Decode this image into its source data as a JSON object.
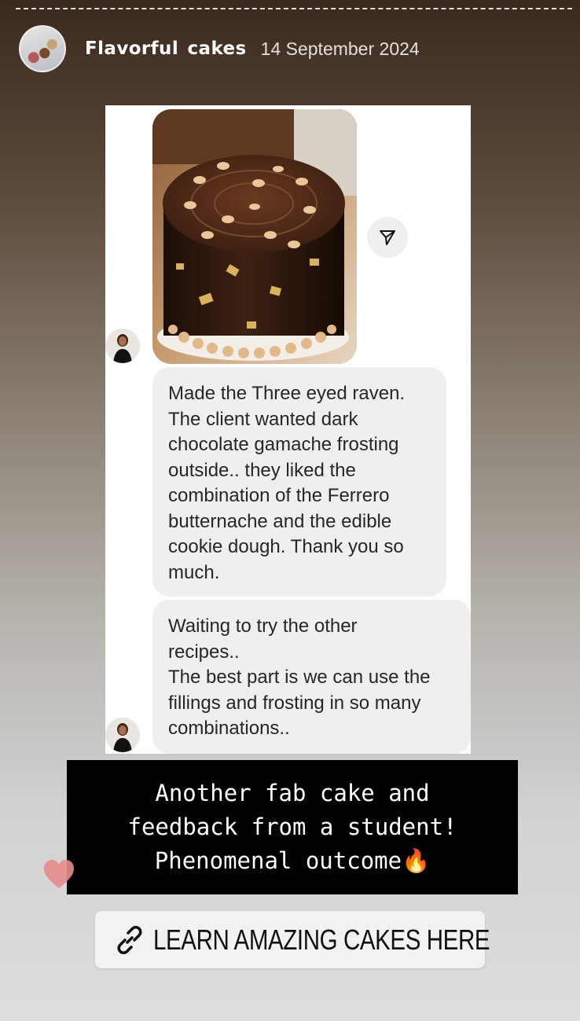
{
  "story": {
    "account_name": "Flavorful  cakes",
    "date": "14 September 2024"
  },
  "chat": {
    "message_1": "Made the Three eyed raven.\nThe client wanted dark\nchocolate gamache frosting\noutside.. they liked the\ncombination of the Ferrero\nbutternache and the edible\ncookie dough. Thank you so\nmuch.",
    "message_2": "Waiting to try the other\nrecipes..\nThe best part is we can use the\nfillings and frosting in so many\ncombinations.."
  },
  "caption": {
    "text": "Another fab cake and\nfeedback from a student!\nPhenomenal outcome🔥"
  },
  "link_sticker": {
    "label": "LEARN AMAZING CAKES HERE",
    "icon": "link-icon"
  },
  "icons": {
    "share": "send-icon",
    "heart": "heart-icon"
  },
  "colors": {
    "bubble": "#efefef",
    "caption_bg": "#000000",
    "heart": "#e58b8b"
  }
}
